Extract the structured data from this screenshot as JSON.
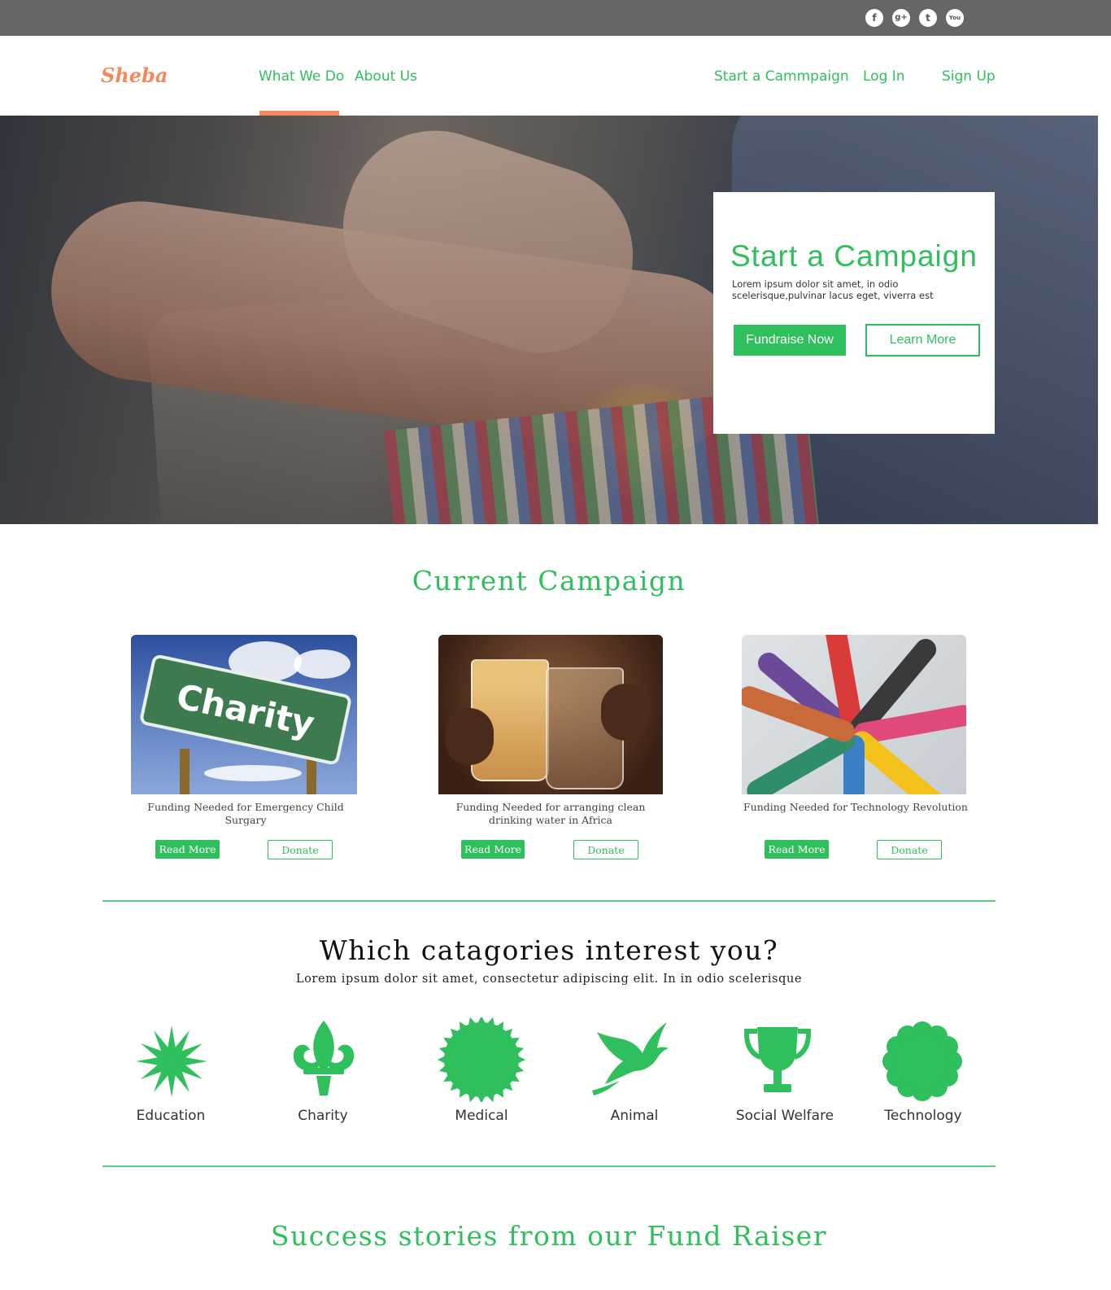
{
  "social": {
    "icons": [
      "facebook-icon",
      "google-plus-icon",
      "twitter-icon",
      "youtube-icon"
    ],
    "glyphs": [
      "f",
      "g+",
      "t",
      "You"
    ]
  },
  "nav": {
    "logo": "Sheba",
    "left": [
      "What We Do",
      "About Us"
    ],
    "right": [
      "Start a Cammpaign",
      "Log In",
      "Sign Up"
    ],
    "active": "What We Do"
  },
  "hero": {
    "card_title": "Start a Campaign",
    "card_text": "Lorem ipsum dolor sit amet, in odio scelerisque,pulvinar lacus eget, viverra est",
    "primary_button": "Fundraise Now",
    "secondary_button": "Learn More"
  },
  "current": {
    "title": "Current Campaign",
    "cards": [
      {
        "image_text": "Charity",
        "caption": "Funding Needed for Emergency Child Surgary",
        "read_more": "Read More",
        "donate": "Donate"
      },
      {
        "caption": "Funding Needed for arranging clean drinking water in Africa",
        "read_more": "Read More",
        "donate": "Donate"
      },
      {
        "caption": "Funding Needed for Technology Revolution",
        "read_more": "Read More",
        "donate": "Donate"
      }
    ]
  },
  "categories": {
    "title": "Which catagories interest you?",
    "subtitle": "Lorem ipsum dolor sit amet, consectetur adipiscing elit. In in odio scelerisque",
    "items": [
      {
        "label": "Education",
        "icon": "star-burst-icon"
      },
      {
        "label": "Charity",
        "icon": "fleur-de-lis-icon"
      },
      {
        "label": "Medical",
        "icon": "seal-badge-icon"
      },
      {
        "label": "Animal",
        "icon": "dove-icon"
      },
      {
        "label": "Social Welfare",
        "icon": "trophy-icon"
      },
      {
        "label": "Technology",
        "icon": "flower-icon"
      }
    ]
  },
  "stories": {
    "title": "Success stories from our Fund Raiser"
  },
  "colors": {
    "accent": "#2fbf5c",
    "brand": "#f28a5e",
    "topbar": "#666666"
  }
}
